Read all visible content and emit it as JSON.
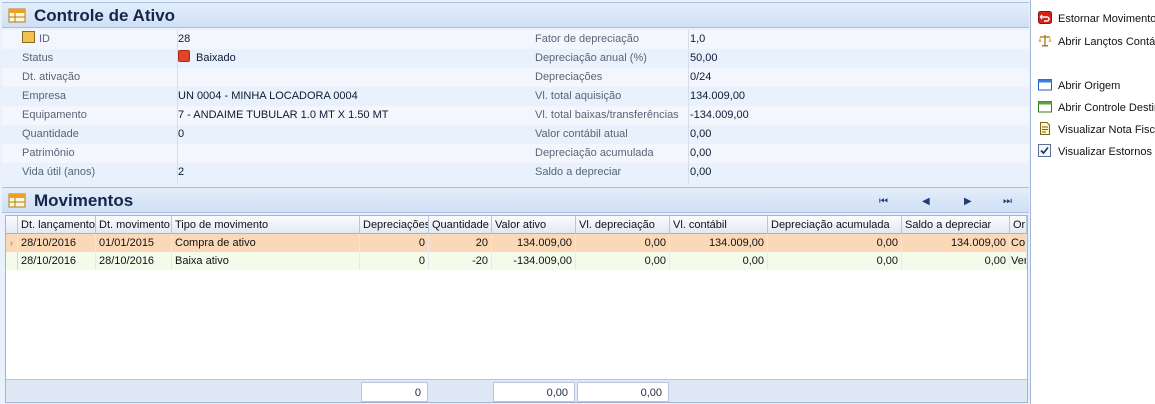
{
  "window_title": "Controle de Ativo",
  "details": {
    "left": [
      {
        "label": "ID",
        "value": "28"
      },
      {
        "label": "Status",
        "value": "Baixado"
      },
      {
        "label": "Dt. ativação",
        "value": ""
      },
      {
        "label": "Empresa",
        "value": "UN 0004 - MINHA LOCADORA 0004"
      },
      {
        "label": "Equipamento",
        "value": "7 - ANDAIME TUBULAR 1.0 MT X 1.50 MT"
      },
      {
        "label": "Quantidade",
        "value": "0"
      },
      {
        "label": "Patrimônio",
        "value": ""
      },
      {
        "label": "Vida útil (anos)",
        "value": "2"
      }
    ],
    "right": [
      {
        "label": "Fator de depreciação",
        "value": "1,0"
      },
      {
        "label": "Depreciação anual (%)",
        "value": "50,00"
      },
      {
        "label": "Depreciações",
        "value": "0/24"
      },
      {
        "label": "Vl. total aquisição",
        "value": "134.009,00"
      },
      {
        "label": "Vl. total baixas/transferências",
        "value": "-134.009,00"
      },
      {
        "label": "Valor contábil atual",
        "value": "0,00"
      },
      {
        "label": "Depreciação acumulada",
        "value": "0,00"
      },
      {
        "label": "Saldo a depreciar",
        "value": "0,00"
      }
    ]
  },
  "movements": {
    "title": "Movimentos",
    "nav": {
      "first": "⏮",
      "prev": "◀",
      "next": "▶",
      "last": "⏭"
    },
    "columns": [
      "Dt. lançamento",
      "Dt. movimento",
      "Tipo de movimento",
      "Depreciações",
      "Quantidade",
      "Valor ativo",
      "Vl. depreciação",
      "Vl. contábil",
      "Depreciação acumulada",
      "Saldo a depreciar",
      "Ori"
    ],
    "rows": [
      [
        "28/10/2016",
        "01/01/2015",
        "Compra de ativo",
        "0",
        "20",
        "134.009,00",
        "0,00",
        "134.009,00",
        "0,00",
        "134.009,00",
        "Co"
      ],
      [
        "28/10/2016",
        "28/10/2016",
        "Baixa ativo",
        "0",
        "-20",
        "-134.009,00",
        "0,00",
        "0,00",
        "0,00",
        "0,00",
        "Ver"
      ]
    ],
    "totals": {
      "quantidade": "0",
      "valor_ativo": "0,00",
      "vl_depreciacao": "0,00"
    }
  },
  "actions": [
    {
      "label": "Estornar Movimento",
      "icon": "undo-icon"
    },
    {
      "label": "Abrir Lançtos Contál",
      "icon": "scales-icon"
    },
    {
      "label": "Abrir Origem",
      "icon": "window-icon"
    },
    {
      "label": "Abrir Controle Destin",
      "icon": "window-green-icon"
    },
    {
      "label": "Visualizar Nota Fiscal",
      "icon": "document-icon"
    },
    {
      "label": "Visualizar Estornos",
      "icon": "checkbox-icon",
      "checked": true
    }
  ],
  "colors": {
    "selected_row": "#fbd9b8",
    "alt_row": "#f4fbea",
    "status": "#e2452a"
  }
}
